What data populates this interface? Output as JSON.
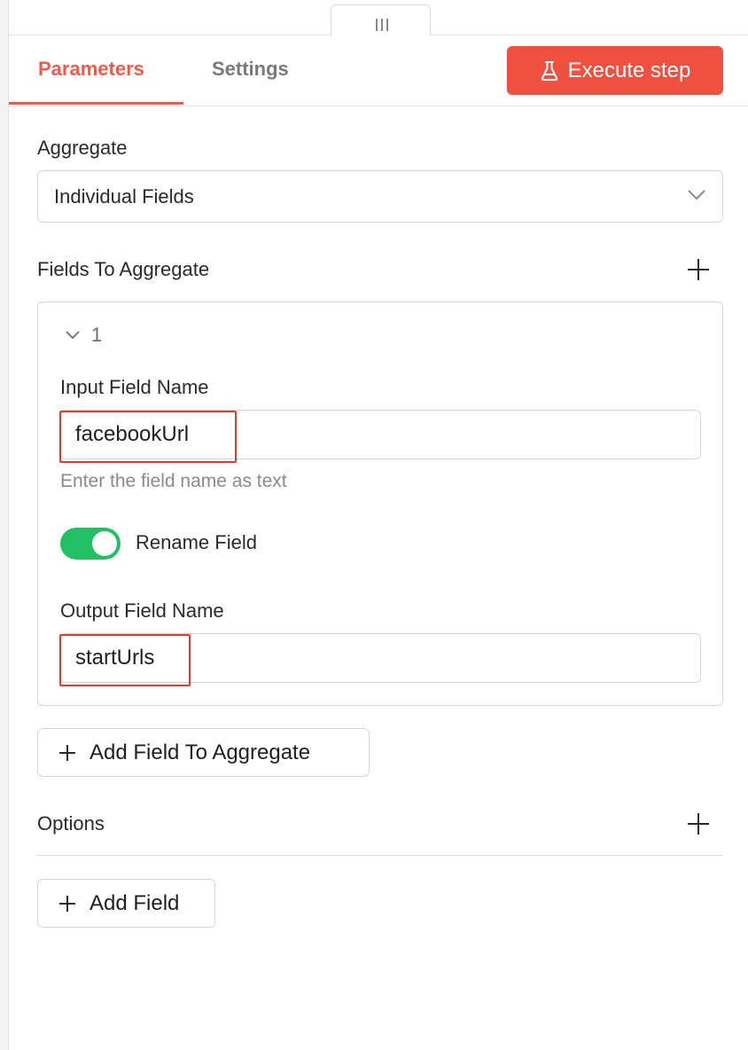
{
  "tabs": {
    "parameters": "Parameters",
    "settings": "Settings"
  },
  "execute_button": {
    "label": "Execute step",
    "icon": "flask-icon",
    "color": "#f0503f"
  },
  "accent_color": "#f05a4a",
  "aggregate": {
    "label": "Aggregate",
    "selected": "Individual Fields"
  },
  "fields_to_aggregate": {
    "label": "Fields To Aggregate",
    "item": {
      "index": "1",
      "input_field_label": "Input Field Name",
      "input_field_value": "facebookUrl",
      "input_field_hint": "Enter the field name as text",
      "rename_toggle_label": "Rename Field",
      "rename_toggle_on": true,
      "output_field_label": "Output Field Name",
      "output_field_value": "startUrls"
    },
    "add_button": "Add Field To Aggregate"
  },
  "options": {
    "label": "Options",
    "add_button": "Add Field"
  },
  "toggle_color": "#22c063",
  "highlight_color": "#e33a2f"
}
